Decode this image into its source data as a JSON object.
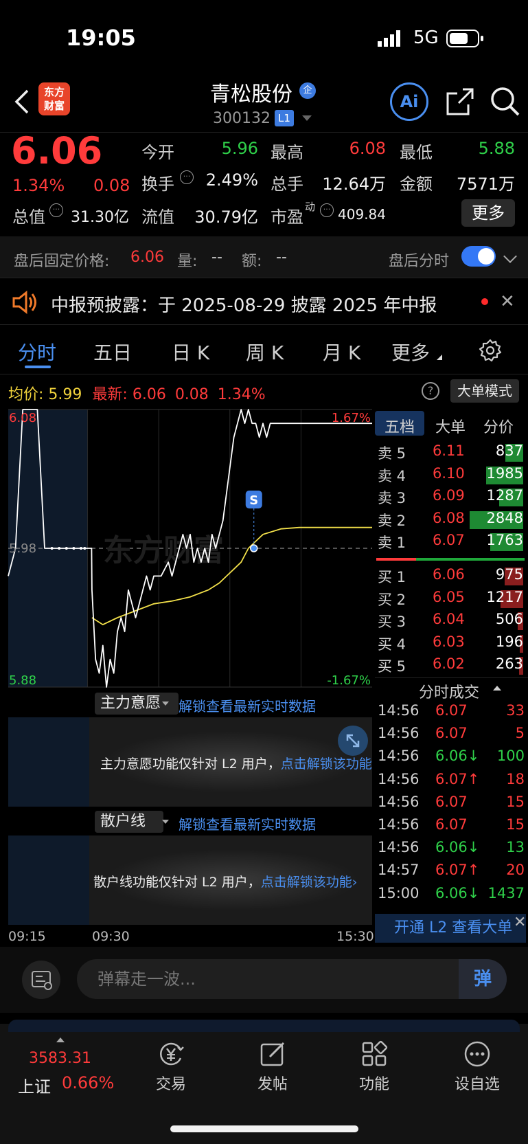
{
  "status_bar": {
    "time": "19:05",
    "network": "5G"
  },
  "header": {
    "logo_line1": "东方",
    "logo_line2": "财富",
    "stock_name": "青松股份",
    "badge": "企",
    "stock_code": "300132",
    "level_badge": "L1",
    "ai_label": "Ai"
  },
  "quote": {
    "price": "6.06",
    "change_pct": "1.34%",
    "change": "0.08",
    "open_label": "今开",
    "open": "5.96",
    "high_label": "最高",
    "high": "6.08",
    "low_label": "最低",
    "low": "5.88",
    "turnover_label": "换手",
    "turnover": "2.49%",
    "volume_label": "总手",
    "volume": "12.64万",
    "amount_label": "金额",
    "amount": "7571万",
    "mktcap_label": "总值",
    "mktcap": "31.30亿",
    "float_label": "流值",
    "float": "30.79亿",
    "pe_label": "市盈",
    "pe_sup": "动",
    "pe": "409.84",
    "more_label": "更多"
  },
  "after_hours": {
    "label": "盘后固定价格:",
    "price": "6.06",
    "vol_label": "量:",
    "vol": "--",
    "amt_label": "额:",
    "amt": "--",
    "split_label": "盘后分时",
    "toggle_on": true
  },
  "notice": {
    "text": "中报预披露：于 2025-08-29 披露 2025 年中报",
    "close": "✕"
  },
  "tabs": [
    {
      "label": "分时",
      "active": true
    },
    {
      "label": "五日"
    },
    {
      "label": "日 K"
    },
    {
      "label": "周 K"
    },
    {
      "label": "月 K"
    },
    {
      "label": "更多"
    }
  ],
  "info_line": {
    "avg_label": "均价:",
    "avg": "5.99",
    "latest_label": "最新:",
    "latest": "6.06",
    "latest_change": "0.08",
    "latest_pct": "1.34%",
    "help": "?",
    "bigorder_label": "大单模式"
  },
  "chart_data": {
    "type": "line",
    "xlabel": "",
    "ylabel": "",
    "ylim": [
      5.88,
      6.08
    ],
    "y_tick_labels": [
      "6.08",
      "5.98",
      "5.88"
    ],
    "pct_labels": [
      "1.67%",
      "-1.67%"
    ],
    "time_labels": [
      "09:15",
      "09:30",
      "15:30"
    ],
    "marker_label": "S",
    "series": [],
    "colors": {
      "price": "#ffffff",
      "avg": "#f2e04a",
      "pre_market_bg": "#0e1a2a"
    },
    "price_points": [
      [
        0,
        5.96
      ],
      [
        0.02,
        5.98
      ],
      [
        0.04,
        6.08
      ],
      [
        0.08,
        6.08
      ],
      [
        0.1,
        5.98
      ],
      [
        0.2,
        5.98
      ],
      [
        0.229,
        5.98
      ],
      [
        0.23,
        5.95
      ],
      [
        0.24,
        5.9
      ],
      [
        0.25,
        5.89
      ],
      [
        0.26,
        5.91
      ],
      [
        0.27,
        5.88
      ],
      [
        0.28,
        5.9
      ],
      [
        0.29,
        5.89
      ],
      [
        0.3,
        5.92
      ],
      [
        0.31,
        5.93
      ],
      [
        0.32,
        5.92
      ],
      [
        0.33,
        5.95
      ],
      [
        0.34,
        5.94
      ],
      [
        0.35,
        5.93
      ],
      [
        0.36,
        5.94
      ],
      [
        0.37,
        5.95
      ],
      [
        0.38,
        5.96
      ],
      [
        0.39,
        5.95
      ],
      [
        0.4,
        5.96
      ],
      [
        0.42,
        5.96
      ],
      [
        0.44,
        5.97
      ],
      [
        0.45,
        5.96
      ],
      [
        0.46,
        5.97
      ],
      [
        0.47,
        5.98
      ],
      [
        0.48,
        5.99
      ],
      [
        0.49,
        5.98
      ],
      [
        0.5,
        5.99
      ],
      [
        0.51,
        5.97
      ],
      [
        0.52,
        5.98
      ],
      [
        0.53,
        5.97
      ],
      [
        0.54,
        5.98
      ],
      [
        0.55,
        5.97
      ],
      [
        0.56,
        5.99
      ],
      [
        0.57,
        5.98
      ],
      [
        0.58,
        5.99
      ],
      [
        0.59,
        6.0
      ],
      [
        0.6,
        6.02
      ],
      [
        0.61,
        6.04
      ],
      [
        0.62,
        6.06
      ],
      [
        0.63,
        6.07
      ],
      [
        0.64,
        6.08
      ],
      [
        0.65,
        6.07
      ],
      [
        0.66,
        6.08
      ],
      [
        0.67,
        6.07
      ],
      [
        0.68,
        6.07
      ],
      [
        0.69,
        6.06
      ],
      [
        0.7,
        6.07
      ],
      [
        0.71,
        6.06
      ],
      [
        0.72,
        6.07
      ],
      [
        0.74,
        6.07
      ],
      [
        0.76,
        6.07
      ],
      [
        0.8,
        6.07
      ],
      [
        0.85,
        6.07
      ],
      [
        0.9,
        6.07
      ],
      [
        0.95,
        6.07
      ],
      [
        1.0,
        6.07
      ]
    ],
    "avg_points": [
      [
        0.23,
        5.93
      ],
      [
        0.26,
        5.925
      ],
      [
        0.3,
        5.93
      ],
      [
        0.35,
        5.935
      ],
      [
        0.4,
        5.94
      ],
      [
        0.45,
        5.942
      ],
      [
        0.5,
        5.945
      ],
      [
        0.55,
        5.95
      ],
      [
        0.58,
        5.955
      ],
      [
        0.6,
        5.96
      ],
      [
        0.62,
        5.965
      ],
      [
        0.64,
        5.97
      ],
      [
        0.66,
        5.98
      ],
      [
        0.68,
        5.985
      ],
      [
        0.7,
        5.99
      ],
      [
        0.75,
        5.994
      ],
      [
        0.8,
        5.995
      ],
      [
        0.9,
        5.995
      ],
      [
        1.0,
        5.995
      ]
    ]
  },
  "order_book": {
    "tabs": [
      "五档",
      "大单",
      "分价"
    ],
    "sells": [
      {
        "label": "卖 5",
        "price": "6.11",
        "vol": "837",
        "bar": 0.17
      },
      {
        "label": "卖 4",
        "price": "6.10",
        "vol": "1985",
        "bar": 0.36
      },
      {
        "label": "卖 3",
        "price": "6.09",
        "vol": "1287",
        "bar": 0.23
      },
      {
        "label": "卖 2",
        "price": "6.08",
        "vol": "2848",
        "bar": 0.52
      },
      {
        "label": "卖 1",
        "price": "6.07",
        "vol": "1763",
        "bar": 0.32
      }
    ],
    "buys": [
      {
        "label": "买 1",
        "price": "6.06",
        "vol": "975",
        "bar": 0.18
      },
      {
        "label": "买 2",
        "price": "6.05",
        "vol": "1217",
        "bar": 0.22
      },
      {
        "label": "买 3",
        "price": "6.04",
        "vol": "506",
        "bar": 0.05
      },
      {
        "label": "买 4",
        "price": "6.03",
        "vol": "196",
        "bar": 0.03
      },
      {
        "label": "买 5",
        "price": "6.02",
        "vol": "263",
        "bar": 0.04
      }
    ]
  },
  "ticks": {
    "title": "分时成交",
    "rows": [
      {
        "time": "14:56",
        "price": "6.07",
        "vol": "33",
        "color": "red"
      },
      {
        "time": "14:56",
        "price": "6.07",
        "vol": "5",
        "color": "red"
      },
      {
        "time": "14:56",
        "price": "6.06↓",
        "vol": "100",
        "color": "green"
      },
      {
        "time": "14:56",
        "price": "6.07↑",
        "vol": "18",
        "color": "red"
      },
      {
        "time": "14:56",
        "price": "6.07",
        "vol": "15",
        "color": "red"
      },
      {
        "time": "14:56",
        "price": "6.07",
        "vol": "15",
        "color": "red"
      },
      {
        "time": "14:56",
        "price": "6.06↓",
        "vol": "13",
        "color": "green"
      },
      {
        "time": "14:57",
        "price": "6.07↑",
        "vol": "20",
        "color": "red"
      },
      {
        "time": "15:00",
        "price": "6.06↓",
        "vol": "1437",
        "color": "green"
      }
    ],
    "l2_banner": "开通 L2 查看大单",
    "l2_close": "✕"
  },
  "sub_panels": {
    "main_force": {
      "selector": "主力意愿",
      "link": "解锁查看最新实时数据",
      "text": "主力意愿功能仅针对 L2 用户，",
      "text_link": "点击解锁该功能"
    },
    "retail": {
      "selector": "散户线",
      "link": "解锁查看最新实时数据",
      "text": "散户线功能仅针对 L2 用户，",
      "text_link": "点击解锁该功能"
    }
  },
  "danmaku": {
    "placeholder": "弹幕走一波...",
    "send": "弹"
  },
  "bottom_nav": {
    "index_value": "3583.31",
    "index_name": "上证",
    "index_pct": "0.66%",
    "items": [
      "交易",
      "发帖",
      "功能",
      "设自选"
    ]
  }
}
